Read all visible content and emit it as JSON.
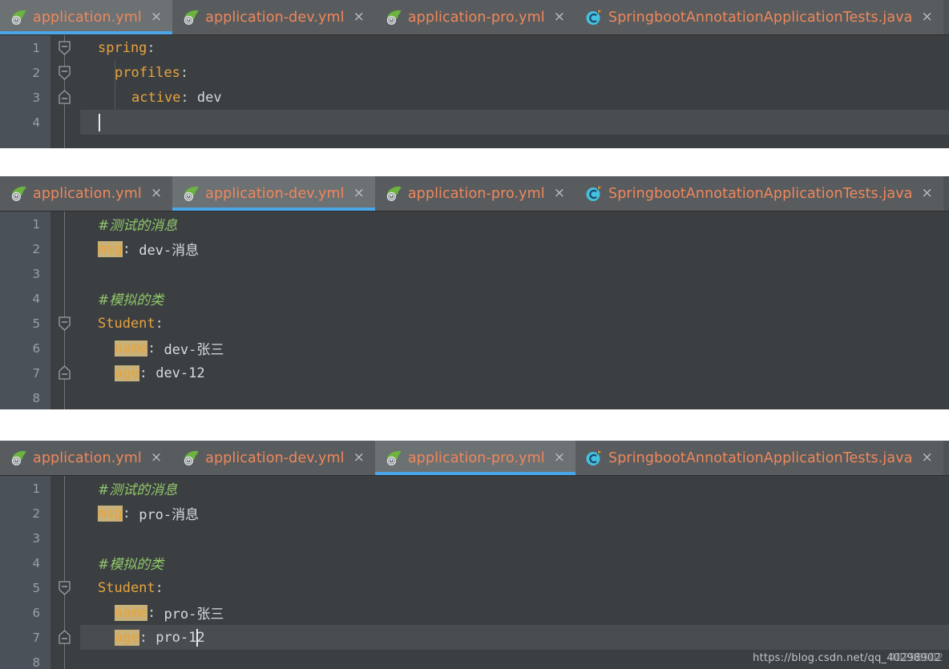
{
  "app": {
    "theme": "IntelliJ IDEA Darcula",
    "accent_blue": "#4ba6e8",
    "tab_text_color": "#f0875b",
    "key_color": "#e8a33d",
    "comment_color": "#8fc66b",
    "value_color": "#d6dbde",
    "gutter_bg": "#4a5159",
    "editor_bg": "#3c3f41",
    "tabbar_bg": "#4e5254",
    "active_tab_bg": "#6c7173",
    "key_highlight_bg": "#c9b17a"
  },
  "watermark": {
    "text": "https://blog.csdn.net/qq_40298902",
    "overlay": "40298902"
  },
  "panels": [
    {
      "id": "panel-application-yml",
      "tabs": [
        {
          "label": "application.yml",
          "icon": "spring-boot-leaf-icon",
          "active": true,
          "close": "×"
        },
        {
          "label": "application-dev.yml",
          "icon": "spring-boot-leaf-icon",
          "active": false,
          "close": "×"
        },
        {
          "label": "application-pro.yml",
          "icon": "spring-boot-leaf-icon",
          "active": false,
          "close": "×"
        },
        {
          "label": "SpringbootAnnotationApplicationTests.java",
          "icon": "java-test-class-icon",
          "active": false,
          "close": "×"
        }
      ],
      "lines": [
        {
          "n": "1",
          "indent": 0,
          "fold": "open-top",
          "segments": [
            {
              "t": "spring",
              "c": "k"
            },
            {
              "t": ":",
              "c": "punct"
            }
          ]
        },
        {
          "n": "2",
          "indent": 1,
          "fold": "open-middle",
          "segments": [
            {
              "t": "profiles",
              "c": "k"
            },
            {
              "t": ":",
              "c": "punct"
            }
          ]
        },
        {
          "n": "3",
          "indent": 2,
          "fold": "open-bottom",
          "segments": [
            {
              "t": "active",
              "c": "k"
            },
            {
              "t": ": ",
              "c": "punct"
            },
            {
              "t": "dev",
              "c": "v"
            }
          ]
        },
        {
          "n": "4",
          "indent": 0,
          "fold": "",
          "current": true,
          "caret": true,
          "segments": []
        }
      ]
    },
    {
      "id": "panel-application-dev-yml",
      "tabs": [
        {
          "label": "application.yml",
          "icon": "spring-boot-leaf-icon",
          "active": false,
          "close": "×"
        },
        {
          "label": "application-dev.yml",
          "icon": "spring-boot-leaf-icon",
          "active": true,
          "close": "×"
        },
        {
          "label": "application-pro.yml",
          "icon": "spring-boot-leaf-icon",
          "active": false,
          "close": "×"
        },
        {
          "label": "SpringbootAnnotationApplicationTests.java",
          "icon": "java-test-class-icon",
          "active": false,
          "close": "×"
        }
      ],
      "lines": [
        {
          "n": "1",
          "indent": 0,
          "fold": "",
          "segments": [
            {
              "t": "#测试的消息",
              "c": "cmt"
            }
          ]
        },
        {
          "n": "2",
          "indent": 0,
          "fold": "",
          "segments": [
            {
              "t": "msg",
              "c": "k-hl"
            },
            {
              "t": ": ",
              "c": "punct"
            },
            {
              "t": "dev-消息",
              "c": "v"
            }
          ]
        },
        {
          "n": "3",
          "indent": 0,
          "fold": "",
          "segments": []
        },
        {
          "n": "4",
          "indent": 0,
          "fold": "",
          "segments": [
            {
              "t": "#模拟的类",
              "c": "cmt"
            }
          ]
        },
        {
          "n": "5",
          "indent": 0,
          "fold": "open-top",
          "segments": [
            {
              "t": "Student",
              "c": "k"
            },
            {
              "t": ":",
              "c": "punct"
            }
          ]
        },
        {
          "n": "6",
          "indent": 1,
          "fold": "",
          "segments": [
            {
              "t": "name",
              "c": "k-hl"
            },
            {
              "t": ": ",
              "c": "punct"
            },
            {
              "t": "dev-张三",
              "c": "v"
            }
          ]
        },
        {
          "n": "7",
          "indent": 1,
          "fold": "open-bottom",
          "segments": [
            {
              "t": "age",
              "c": "k-hl"
            },
            {
              "t": ": ",
              "c": "punct"
            },
            {
              "t": "dev-12",
              "c": "v"
            }
          ]
        },
        {
          "n": "8",
          "indent": 0,
          "fold": "",
          "segments": []
        }
      ]
    },
    {
      "id": "panel-application-pro-yml",
      "tabs": [
        {
          "label": "application.yml",
          "icon": "spring-boot-leaf-icon",
          "active": false,
          "close": "×"
        },
        {
          "label": "application-dev.yml",
          "icon": "spring-boot-leaf-icon",
          "active": false,
          "close": "×"
        },
        {
          "label": "application-pro.yml",
          "icon": "spring-boot-leaf-icon",
          "active": true,
          "close": "×"
        },
        {
          "label": "SpringbootAnnotationApplicationTests.java",
          "icon": "java-test-class-icon",
          "active": false,
          "close": "×"
        }
      ],
      "lines": [
        {
          "n": "1",
          "indent": 0,
          "fold": "",
          "segments": [
            {
              "t": "#测试的消息",
              "c": "cmt"
            }
          ]
        },
        {
          "n": "2",
          "indent": 0,
          "fold": "",
          "segments": [
            {
              "t": "msg",
              "c": "k-hl"
            },
            {
              "t": ": ",
              "c": "punct"
            },
            {
              "t": "pro-消息",
              "c": "v"
            }
          ]
        },
        {
          "n": "3",
          "indent": 0,
          "fold": "",
          "segments": []
        },
        {
          "n": "4",
          "indent": 0,
          "fold": "",
          "segments": [
            {
              "t": "#模拟的类",
              "c": "cmt"
            }
          ]
        },
        {
          "n": "5",
          "indent": 0,
          "fold": "open-top",
          "segments": [
            {
              "t": "Student",
              "c": "k"
            },
            {
              "t": ":",
              "c": "punct"
            }
          ]
        },
        {
          "n": "6",
          "indent": 1,
          "fold": "",
          "segments": [
            {
              "t": "name",
              "c": "k-hl"
            },
            {
              "t": ": ",
              "c": "punct"
            },
            {
              "t": "pro-张三",
              "c": "v"
            }
          ]
        },
        {
          "n": "7",
          "indent": 1,
          "fold": "open-bottom",
          "current": true,
          "caret_after": 10,
          "segments": [
            {
              "t": "age",
              "c": "k-hl"
            },
            {
              "t": ": ",
              "c": "punct"
            },
            {
              "t": "pro-12",
              "c": "v"
            }
          ]
        },
        {
          "n": "8",
          "indent": 0,
          "fold": "",
          "segments": []
        }
      ]
    }
  ]
}
